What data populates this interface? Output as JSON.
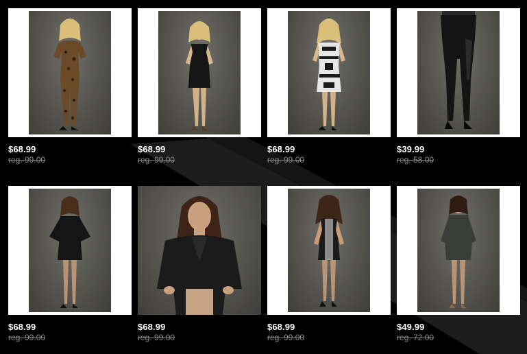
{
  "products": [
    {
      "price": "$68.99",
      "reg_price": "reg. 99.00",
      "image": "leopard-print-jumpsuit-photo"
    },
    {
      "price": "$68.99",
      "reg_price": "reg. 99.00",
      "image": "black-cutout-dress-photo"
    },
    {
      "price": "$68.99",
      "reg_price": "reg. 99.00",
      "image": "black-white-print-dress-photo"
    },
    {
      "price": "$39.99",
      "reg_price": "reg. 58.00",
      "image": "black-leggings-photo"
    },
    {
      "price": "$68.99",
      "reg_price": "reg. 99.00",
      "image": "black-long-sleeve-dress-photo"
    },
    {
      "price": "$68.99",
      "reg_price": "reg. 99.00",
      "image": "black-blazer-photo"
    },
    {
      "price": "$68.99",
      "reg_price": "reg. 99.00",
      "image": "colorblock-slip-dress-photo"
    },
    {
      "price": "$49.99",
      "reg_price": "reg. 72.00",
      "image": "wrap-romper-photo"
    }
  ],
  "colors": {
    "background": "#000000",
    "stripe": "#1c1c1c",
    "price": "#ffffff",
    "reg_price": "#8a8a8a"
  }
}
